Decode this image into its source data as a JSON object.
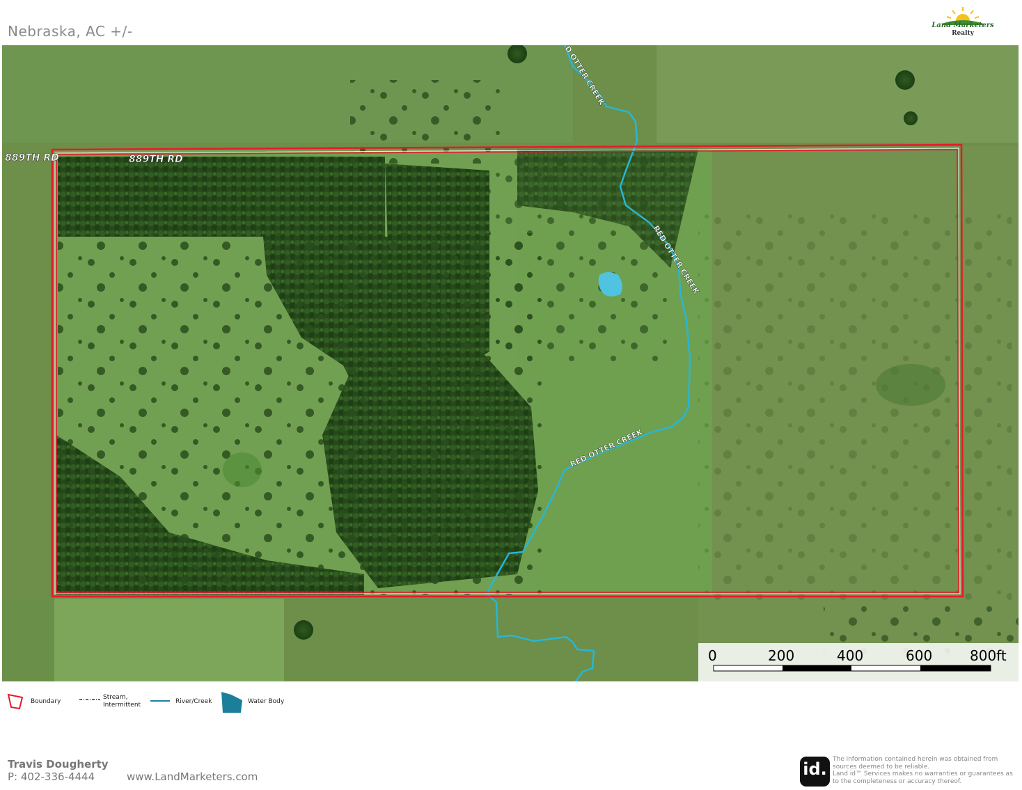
{
  "header": {
    "title": "Nebraska,  AC +/-"
  },
  "logo": {
    "name": "Land Marketers",
    "subtitle": "Realty",
    "icon": "sunrise-icon",
    "color": "#2e6b2c"
  },
  "map": {
    "road_labels": [
      "889TH RD",
      "889TH RD"
    ],
    "creek_labels": [
      "D OTTER CREEK",
      "RED OTTER CREEK",
      "RED OTTER CREEK"
    ],
    "boundary_color": "#e8192c",
    "creek_color": "#29b6d6",
    "water_color": "#4fc3e0"
  },
  "scalebar": {
    "labels": [
      "0",
      "200",
      "400",
      "600",
      "800ft"
    ]
  },
  "legend": {
    "items": [
      {
        "label": "Boundary",
        "icon": "boundary-icon"
      },
      {
        "label": "Stream,\nIntermittent",
        "icon": "stream-intermittent-icon"
      },
      {
        "label": "River/Creek",
        "icon": "river-creek-icon"
      },
      {
        "label": "Water Body",
        "icon": "water-body-icon"
      }
    ]
  },
  "footer": {
    "name": "Travis Dougherty",
    "phone": "P: 402-336-4444",
    "website": "www.LandMarketers.com",
    "disclaimer": "The information contained herein was obtained from sources deemed to be reliable.\n Land id™ Services makes no warranties or guarantees as to the completeness or accuracy thereof.",
    "id_logo": "id."
  }
}
